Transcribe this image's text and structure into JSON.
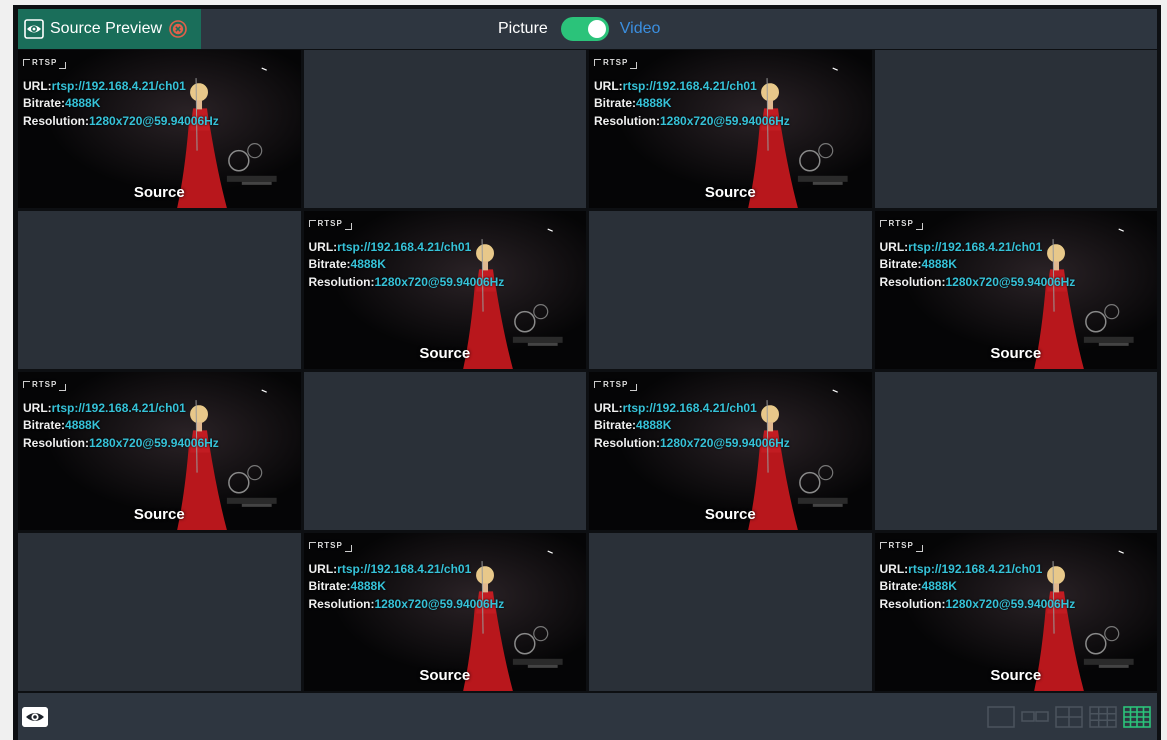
{
  "header": {
    "tab_label": "Source Preview",
    "mode_left": "Picture",
    "mode_right": "Video",
    "toggle_on": true
  },
  "colors": {
    "accent_green": "#1a6e5a",
    "toggle_green": "#2bc37a",
    "link_blue": "#3b8fe0",
    "value_cyan": "#36c2d8",
    "selected_outline": "#2ab6c8"
  },
  "stream": {
    "protocol": "RTSP",
    "url_label": "URL:",
    "url_value": "rtsp://192.168.4.21/ch01",
    "bitrate_label": "Bitrate:",
    "bitrate_value": "4888K",
    "resolution_label": "Resolution:",
    "resolution_value": "1280x720@59.94006Hz",
    "source_label": "Source"
  },
  "grid": {
    "rows": 4,
    "cols": 4,
    "cells": [
      1,
      0,
      1,
      0,
      0,
      1,
      0,
      1,
      1,
      0,
      1,
      0,
      0,
      1,
      0,
      1
    ],
    "selected_index": 15
  },
  "footer": {
    "icon": "eye-icon",
    "layouts": [
      "layout-1x1-icon",
      "layout-1x2-icon",
      "layout-2x2-icon",
      "layout-3x3-icon",
      "layout-4x4-icon"
    ],
    "active_layout": 4
  }
}
